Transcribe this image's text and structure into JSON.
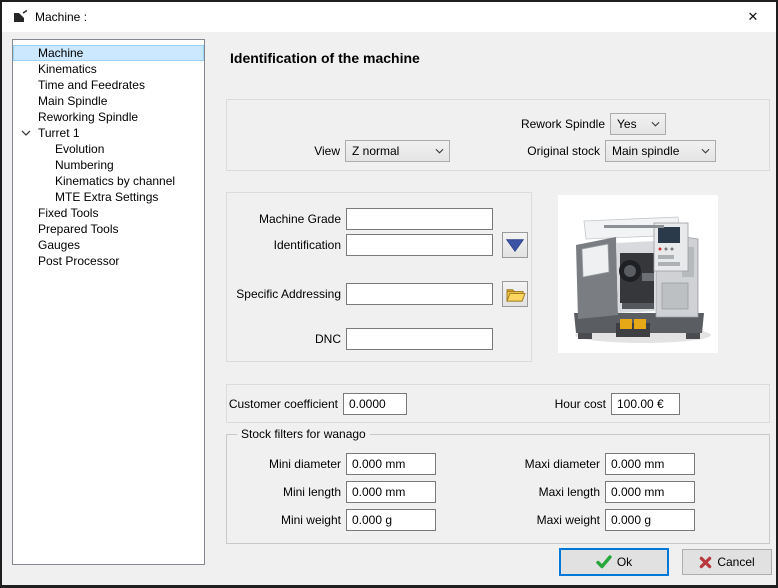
{
  "window": {
    "title": "Machine :",
    "close_glyph": "✕"
  },
  "tree": {
    "items": [
      {
        "label": "Machine",
        "level": 0,
        "selected": true
      },
      {
        "label": "Kinematics",
        "level": 0
      },
      {
        "label": "Time and Feedrates",
        "level": 0
      },
      {
        "label": "Main Spindle",
        "level": 0
      },
      {
        "label": "Reworking Spindle",
        "level": 0
      },
      {
        "label": "Turret 1",
        "level": 0,
        "expanded": true
      },
      {
        "label": "Evolution",
        "level": 1
      },
      {
        "label": "Numbering",
        "level": 1
      },
      {
        "label": "Kinematics by channel",
        "level": 1
      },
      {
        "label": "MTE Extra Settings",
        "level": 1
      },
      {
        "label": "Fixed Tools",
        "level": 0
      },
      {
        "label": "Prepared Tools",
        "level": 0
      },
      {
        "label": "Gauges",
        "level": 0
      },
      {
        "label": "Post Processor",
        "level": 0
      }
    ]
  },
  "main": {
    "heading": "Identification of the machine",
    "view_group": {
      "rework_spindle_label": "Rework Spindle",
      "rework_spindle_value": "Yes",
      "view_label": "View",
      "view_value": "Z normal",
      "original_stock_label": "Original stock",
      "original_stock_value": "Main spindle"
    },
    "identification_group": {
      "machine_grade_label": "Machine Grade",
      "machine_grade_value": "",
      "identification_label": "Identification",
      "identification_value": "",
      "specific_addressing_label": "Specific Addressing",
      "specific_addressing_value": "",
      "dnc_label": "DNC",
      "dnc_value": ""
    },
    "cost_group": {
      "customer_coefficient_label": "Customer coefficient",
      "customer_coefficient_value": "0.0000",
      "hour_cost_label": "Hour cost",
      "hour_cost_value": "100.00 €"
    },
    "stock_filters_group": {
      "title": "Stock filters for wanago",
      "rows": [
        {
          "left_label": "Mini diameter",
          "left_value": "0.000 mm",
          "right_label": "Maxi diameter",
          "right_value": "0.000 mm"
        },
        {
          "left_label": "Mini length",
          "left_value": "0.000 mm",
          "right_label": "Maxi length",
          "right_value": "0.000 mm"
        },
        {
          "left_label": "Mini weight",
          "left_value": "0.000 g",
          "right_label": "Maxi weight",
          "right_value": "0.000 g"
        }
      ]
    }
  },
  "footer": {
    "ok_label": "Ok",
    "cancel_label": "Cancel"
  },
  "colors": {
    "accent_blue": "#0078d7",
    "selection_bg": "#cce8ff",
    "selection_border": "#99d1ff",
    "ok_check_green": "#27a83c",
    "cancel_x_red": "#b8383e",
    "dropdown_arrow_blue": "#3a53a5",
    "folder_yellow": "#f5c84c"
  }
}
